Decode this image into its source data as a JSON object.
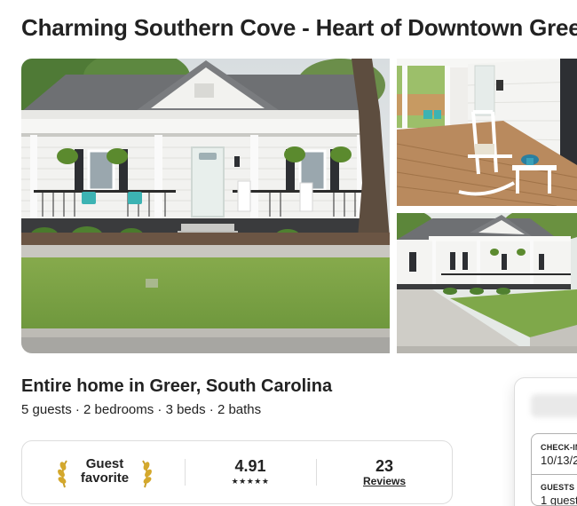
{
  "listing": {
    "title": "Charming Southern Cove - Heart of Downtown Greer",
    "subtitle": "Entire home in Greer, South Carolina",
    "details": "5 guests · 2 bedrooms · 3 beds · 2 baths"
  },
  "photos": [
    {
      "subject": "front view of white house with porch"
    },
    {
      "subject": "covered porch with white rocking chair"
    },
    {
      "subject": "side street view of house and driveway"
    }
  ],
  "highlights": {
    "badge_line1": "Guest",
    "badge_line2": "favorite",
    "rating": "4.91",
    "stars": "★★★★★",
    "review_count": "23",
    "review_label": "Reviews"
  },
  "booking": {
    "checkin_label": "CHECK-IN",
    "checkin_value": "10/13/2",
    "guests_label": "GUESTS",
    "guests_value": "1 guest"
  },
  "colors": {
    "text": "#222222",
    "border": "#dddddd",
    "siding": "#f4f4f2",
    "roof": "#6e7073",
    "lawn": "#7fa84a",
    "teal_chair": "#3cb3b3"
  }
}
